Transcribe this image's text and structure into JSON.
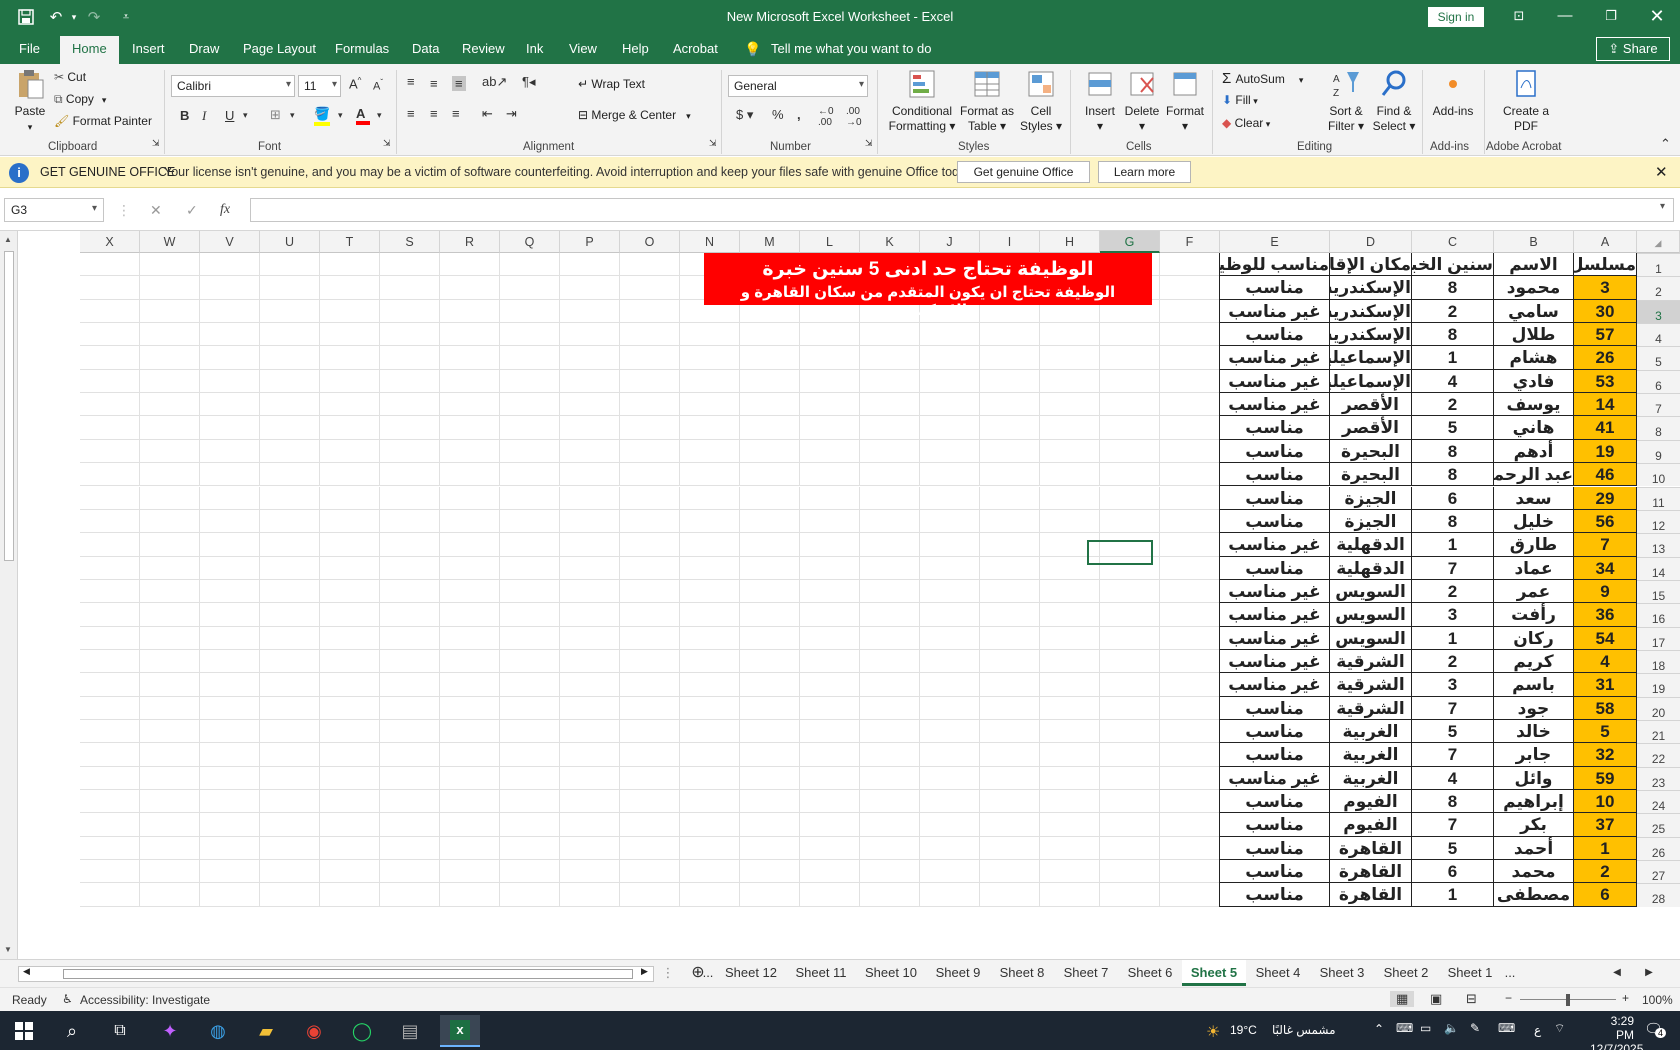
{
  "window": {
    "title": "New Microsoft Excel Worksheet  -  Excel",
    "sign_in": "Sign in"
  },
  "ribbon_tabs": [
    "File",
    "Home",
    "Insert",
    "Draw",
    "Page Layout",
    "Formulas",
    "Data",
    "Review",
    "Ink",
    "View",
    "Help",
    "Acrobat"
  ],
  "active_tab": "Home",
  "tell_me": "Tell me what you want to do",
  "share": "Share",
  "ribbon": {
    "clipboard": {
      "paste": "Paste",
      "cut": "Cut",
      "copy": "Copy",
      "format_painter": "Format Painter",
      "label": "Clipboard"
    },
    "font": {
      "name": "Calibri",
      "size": "11",
      "label": "Font"
    },
    "alignment": {
      "wrap_text": "Wrap Text",
      "merge_center": "Merge & Center",
      "label": "Alignment"
    },
    "number": {
      "format": "General",
      "label": "Number"
    },
    "styles": {
      "conditional": "Conditional Formatting",
      "format_table": "Format as Table",
      "cell_styles": "Cell Styles",
      "label": "Styles"
    },
    "cells": {
      "insert": "Insert",
      "delete": "Delete",
      "format": "Format",
      "label": "Cells"
    },
    "editing": {
      "autosum": "AutoSum",
      "fill": "Fill",
      "clear": "Clear",
      "sort_filter": "Sort & Filter",
      "find_select": "Find & Select",
      "label": "Editing"
    },
    "addins": {
      "addins": "Add-ins",
      "label": "Add-ins"
    },
    "acrobat": {
      "create_pdf": "Create a PDF",
      "label": "Adobe Acrobat"
    }
  },
  "notice": {
    "heading": "GET GENUINE OFFICE",
    "message": "Your license isn't genuine, and you may be a victim of software counterfeiting. Avoid interruption and keep your files safe with genuine Office today.",
    "get_button": "Get genuine Office",
    "learn_button": "Learn more"
  },
  "name_box": "G3",
  "formula": "",
  "columns": [
    "A",
    "B",
    "C",
    "D",
    "E",
    "F",
    "G",
    "H",
    "I",
    "J",
    "K",
    "L",
    "M",
    "N",
    "O",
    "P",
    "Q",
    "R",
    "S",
    "T",
    "U",
    "V",
    "W",
    "X"
  ],
  "table": {
    "headers": [
      "مسلسل",
      "الاسم",
      "سنين الخبرة",
      "مكان الإقامة",
      "مناسب للوظيفة"
    ],
    "rows": [
      [
        "3",
        "محمود",
        "8",
        "الإسكندرية",
        "مناسب"
      ],
      [
        "30",
        "سامي",
        "2",
        "الإسكندرية",
        "غير مناسب"
      ],
      [
        "57",
        "طلال",
        "8",
        "الإسكندرية",
        "مناسب"
      ],
      [
        "26",
        "هشام",
        "1",
        "الإسماعيلية",
        "غير مناسب"
      ],
      [
        "53",
        "فادي",
        "4",
        "الإسماعيلية",
        "غير مناسب"
      ],
      [
        "14",
        "يوسف",
        "2",
        "الأقصر",
        "غير مناسب"
      ],
      [
        "41",
        "هاني",
        "5",
        "الأقصر",
        "مناسب"
      ],
      [
        "19",
        "أدهم",
        "8",
        "البحيرة",
        "مناسب"
      ],
      [
        "46",
        "عبد الرحمن",
        "8",
        "البحيرة",
        "مناسب"
      ],
      [
        "29",
        "سعد",
        "6",
        "الجيزة",
        "مناسب"
      ],
      [
        "56",
        "خليل",
        "8",
        "الجيزة",
        "مناسب"
      ],
      [
        "7",
        "طارق",
        "1",
        "الدقهلية",
        "غير مناسب"
      ],
      [
        "34",
        "عماد",
        "7",
        "الدقهلية",
        "مناسب"
      ],
      [
        "9",
        "عمر",
        "2",
        "السويس",
        "غير مناسب"
      ],
      [
        "36",
        "رأفت",
        "3",
        "السويس",
        "غير مناسب"
      ],
      [
        "54",
        "ركان",
        "1",
        "السويس",
        "غير مناسب"
      ],
      [
        "4",
        "كريم",
        "2",
        "الشرقية",
        "غير مناسب"
      ],
      [
        "31",
        "باسم",
        "3",
        "الشرقية",
        "غير مناسب"
      ],
      [
        "58",
        "جود",
        "7",
        "الشرقية",
        "مناسب"
      ],
      [
        "5",
        "خالد",
        "5",
        "الغربية",
        "مناسب"
      ],
      [
        "32",
        "جابر",
        "7",
        "الغربية",
        "مناسب"
      ],
      [
        "59",
        "وائل",
        "4",
        "الغربية",
        "غير مناسب"
      ],
      [
        "10",
        "إبراهيم",
        "8",
        "الفيوم",
        "مناسب"
      ],
      [
        "37",
        "بكر",
        "7",
        "الفيوم",
        "مناسب"
      ],
      [
        "1",
        "أحمد",
        "5",
        "القاهرة",
        "مناسب"
      ],
      [
        "2",
        "محمد",
        "6",
        "القاهرة",
        "مناسب"
      ],
      [
        "6",
        "مصطفى",
        "1",
        "القاهرة",
        "مناسب"
      ]
    ]
  },
  "banner": {
    "line1": "الوظيفة تحتاج حد ادنى 5 سنين خبرة",
    "line2": "الوظيفة تحتاج ان يكون المتقدم من سكان القاهرة و الإسكندرية"
  },
  "sheet_tabs": [
    "...",
    "Sheet 12",
    "Sheet 11",
    "Sheet 10",
    "Sheet 9",
    "Sheet 8",
    "Sheet 7",
    "Sheet 6",
    "Sheet 5",
    "Sheet 4",
    "Sheet 3",
    "Sheet 2",
    "Sheet 1",
    "..."
  ],
  "active_sheet": "Sheet 5",
  "status": {
    "ready": "Ready",
    "accessibility": "Accessibility: Investigate",
    "zoom": "100%"
  },
  "taskbar": {
    "weather_temp": "19°C",
    "weather_text": "مشمس غالبًا",
    "lang": "ع",
    "time": "3:29 PM",
    "date": "12/7/2025",
    "notif_count": "4"
  },
  "colors": {
    "excel_green": "#217346",
    "highlight_yellow": "#ffc000",
    "banner_red": "#ff0000"
  }
}
